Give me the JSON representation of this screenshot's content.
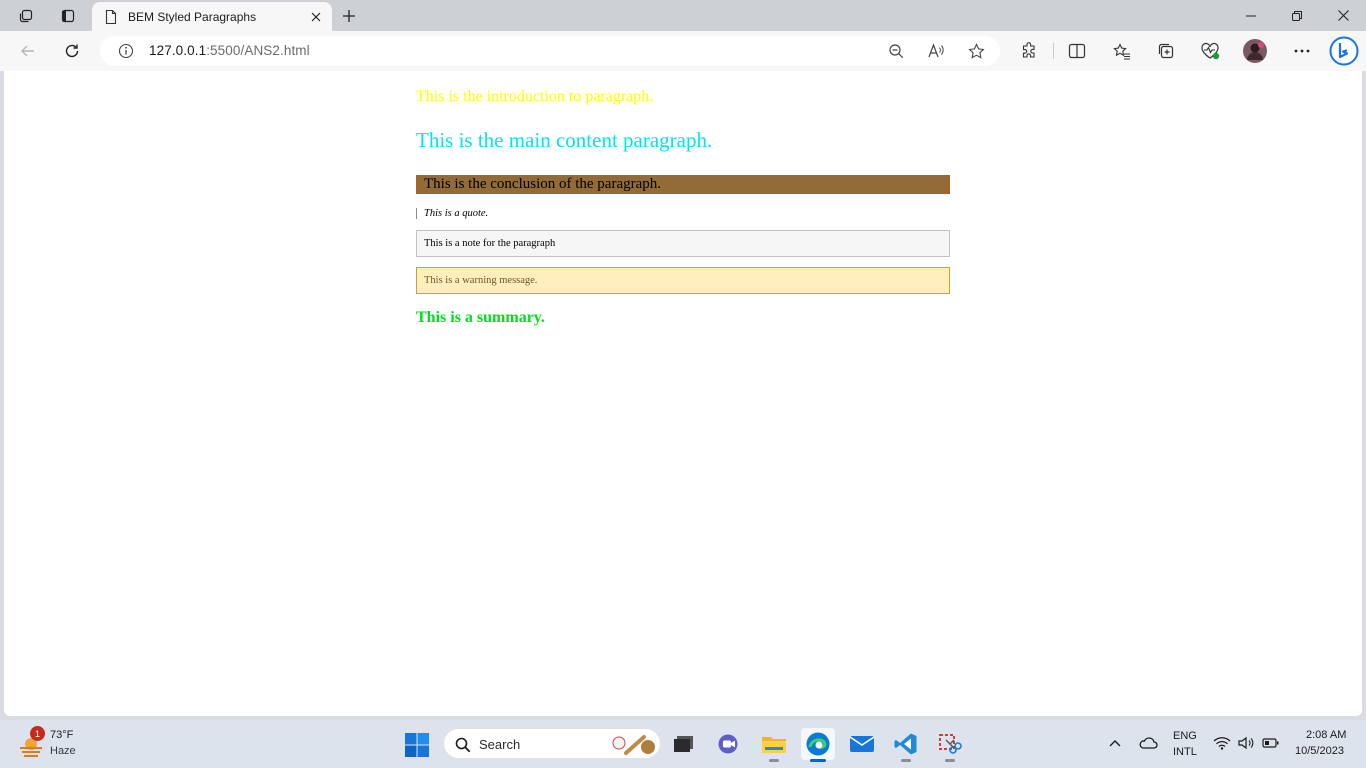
{
  "browser": {
    "tab": {
      "title": "BEM Styled Paragraphs"
    },
    "address": {
      "host": "127.0.0.1",
      "rest": ":5500/ANS2.html"
    }
  },
  "page": {
    "intro": "This is the introduction to paragraph.",
    "main": "This is the main content paragraph.",
    "conclusion": "This is the conclusion of the paragraph.",
    "quote": "This is a quote.",
    "note": "This is a note for the paragraph",
    "warning": "This is a warning message.",
    "summary": "This is a summary."
  },
  "taskbar": {
    "weather": {
      "badge": "1",
      "temp": "73°F",
      "condition": "Haze"
    },
    "search_label": "Search",
    "tray": {
      "lang1": "ENG",
      "lang2": "INTL",
      "time": "2:08 AM",
      "date": "10/5/2023"
    }
  },
  "colors": {
    "intro": "#ffff00",
    "main": "#00e5ee",
    "conclusion_bg": "#936b37",
    "warning_bg": "#ffefbd",
    "summary": "#00e01a",
    "accent": "#0067c0"
  }
}
